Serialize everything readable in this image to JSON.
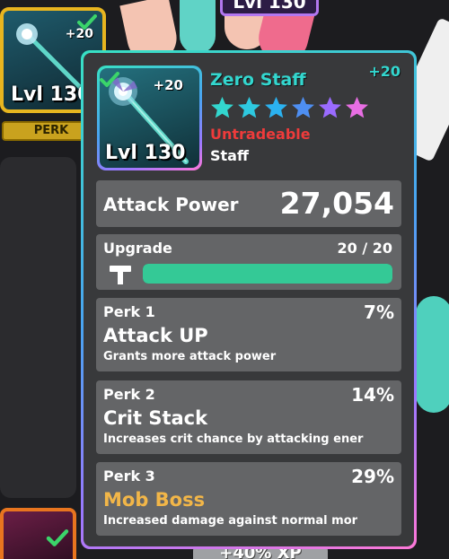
{
  "background": {
    "left_slot": {
      "level": "Lvl 130",
      "plus": "+20"
    },
    "perk_tag": "PERK",
    "top_slot_level": "Lvl 130",
    "bottom_bar_text": "+40% XP"
  },
  "tooltip": {
    "icon": {
      "level": "Lvl 130",
      "plus": "+20"
    },
    "name": "Zero Staff",
    "upgrade_badge": "+20",
    "stars": [
      {
        "color": "#33d7cf"
      },
      {
        "color": "#2ec9e0"
      },
      {
        "color": "#2bb2f0"
      },
      {
        "color": "#4e8ff2"
      },
      {
        "color": "#9a6bff"
      },
      {
        "color": "#e86ee3"
      }
    ],
    "trade_status": "Untradeable",
    "type": "Staff",
    "attack": {
      "label": "Attack Power",
      "value": "27,054"
    },
    "upgrade": {
      "label": "Upgrade",
      "progress_text": "20 / 20",
      "fill_fraction": 1.0
    },
    "perks": [
      {
        "title": "Perk 1",
        "percent": "7%",
        "name": "Attack UP",
        "description": "Grants more attack power",
        "name_color": "white"
      },
      {
        "title": "Perk 2",
        "percent": "14%",
        "name": "Crit Stack",
        "description": "Increases crit chance by attacking ener",
        "name_color": "white"
      },
      {
        "title": "Perk 3",
        "percent": "29%",
        "name": "Mob Boss",
        "description": "Increased damage against normal mor",
        "name_color": "gold"
      }
    ]
  },
  "colors": {
    "panel_gradient": [
      "#38e1c3",
      "#4aa3f2",
      "#9b78ff",
      "#ff78d8"
    ],
    "name_color": "#33d7cf",
    "untradeable_color": "#ee3b3b",
    "bar_fill": "#34c996",
    "gold_perk": "#f2b648"
  }
}
